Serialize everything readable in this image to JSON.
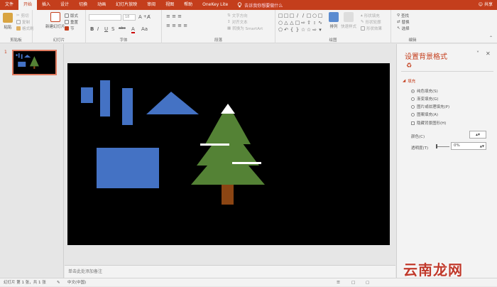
{
  "tabs": [
    "文件",
    "开始",
    "插入",
    "设计",
    "切换",
    "动画",
    "幻灯片放映",
    "审阅",
    "视图",
    "帮助",
    "OneKey Lite"
  ],
  "active_tab": "开始",
  "tell_me": "告诉我你想要做什么",
  "user": "共享",
  "ribbon": {
    "clipboard": {
      "paste": "粘贴",
      "cut": "剪切",
      "copy": "复制",
      "format_painter": "格式刷",
      "label": "剪贴板"
    },
    "slides": {
      "new_slide": "新建幻灯片",
      "layout": "版式",
      "reset": "重置",
      "section": "节",
      "label": "幻灯片"
    },
    "font": {
      "size": "18",
      "bold": "B",
      "italic": "I",
      "underline": "U",
      "shadow": "S",
      "strike": "abc",
      "label": "字体"
    },
    "paragraph": {
      "text_direction": "文字方向",
      "align_text": "对齐文本",
      "smartart": "转换为 SmartArt",
      "label": "段落"
    },
    "drawing": {
      "arrange": "排列",
      "quick_styles": "快速样式",
      "fill": "形状填充",
      "outline": "形状轮廓",
      "effects": "形状效果",
      "label": "绘图"
    },
    "editing": {
      "find": "查找",
      "replace": "替换",
      "select": "选择",
      "label": "编辑"
    }
  },
  "thumbnail": {
    "number": "1"
  },
  "notes_placeholder": "单击此处添加备注",
  "panel": {
    "title": "设置背景格式",
    "section": "填充",
    "options": [
      {
        "label": "纯色填充(S)",
        "checked": true
      },
      {
        "label": "渐变填充(G)",
        "checked": false
      },
      {
        "label": "图片或纹理填充(P)",
        "checked": false
      },
      {
        "label": "图案填充(A)",
        "checked": false
      }
    ],
    "hide_bg": "隐藏背景图形(H)",
    "color_label": "颜色(C)",
    "transparency_label": "透明度(T)",
    "transparency_value": "0%"
  },
  "status": {
    "slide_info": "幻灯片 第 1 张，共 1 张",
    "language": "中文(中国)"
  },
  "watermark": "云南龙网",
  "colors": {
    "accent": "#c43e1c",
    "shape_blue": "#4472c4",
    "tree_green": "#548235",
    "trunk": "#8b4513",
    "slide_bg": "#000000"
  }
}
